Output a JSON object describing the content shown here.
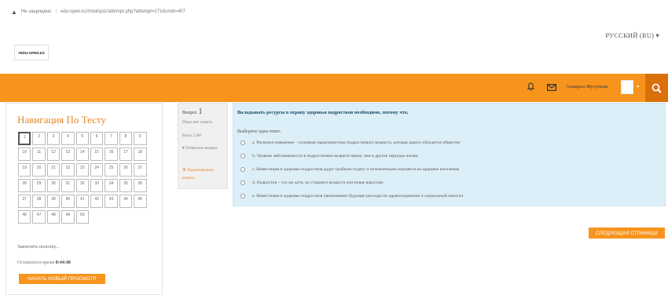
{
  "browser": {
    "security_label": "Не защищено",
    "url": "edu-open.kz/mod/quiz/attempt.php?attempt=1718cmid=407"
  },
  "header": {
    "logo_text": "#EDU-OPEN.KZ",
    "language": "РУССКИЙ (RU) ▾"
  },
  "navbar": {
    "user_name": "Ахмарал Жусупова",
    "accent_color": "#f7941d"
  },
  "quiz_nav": {
    "title": "Навигация По Тесту",
    "questions": [
      "1",
      "2",
      "3",
      "4",
      "5",
      "6",
      "7",
      "8",
      "9",
      "10",
      "11",
      "12",
      "13",
      "14",
      "15",
      "16",
      "17",
      "18",
      "19",
      "20",
      "21",
      "22",
      "23",
      "24",
      "25",
      "26",
      "27",
      "28",
      "29",
      "30",
      "31",
      "32",
      "33",
      "34",
      "35",
      "36",
      "37",
      "38",
      "39",
      "40",
      "41",
      "42",
      "43",
      "44",
      "45",
      "46",
      "47",
      "48",
      "49",
      "50"
    ],
    "finish_link": "Закончить попытку...",
    "time_label": "Оставшееся время",
    "time_value": "0:44:48",
    "new_preview_button": "НАЧАТЬ НОВЫЙ ПРОСМОТР"
  },
  "question_info": {
    "label": "Вопрос",
    "number": "1",
    "state": "Пока нет ответа",
    "grade": "Балл: 2,00",
    "flag_label": "Отметить вопрос",
    "edit_label": "Редактировать вопрос"
  },
  "question": {
    "text": "Вкладывать ресурсы в охрану здоровья подростков необходимо, потому что,",
    "prompt": "Выберите один ответ:",
    "options": [
      "a. Рисковое поведение – основная характеристика подросткового возраста, которая дорого обходится обществу",
      "b. Уровень заболеваемости в подростковом возрасте выше, чем в другие периоды жизни",
      "c. Инвестиции в здоровье подростков дадут тройную отдачу и положительно отразятся на здоровье населения",
      "d. Подростки – это же дети, но старшего возраста или юные взрослые",
      "e. Инвестиции в здоровье подростков увеличивают будущие расходы на здравоохранение и социальный капитал"
    ]
  },
  "next_page_button": "СЛЕДУЮЩАЯ СТРАНИЦА"
}
